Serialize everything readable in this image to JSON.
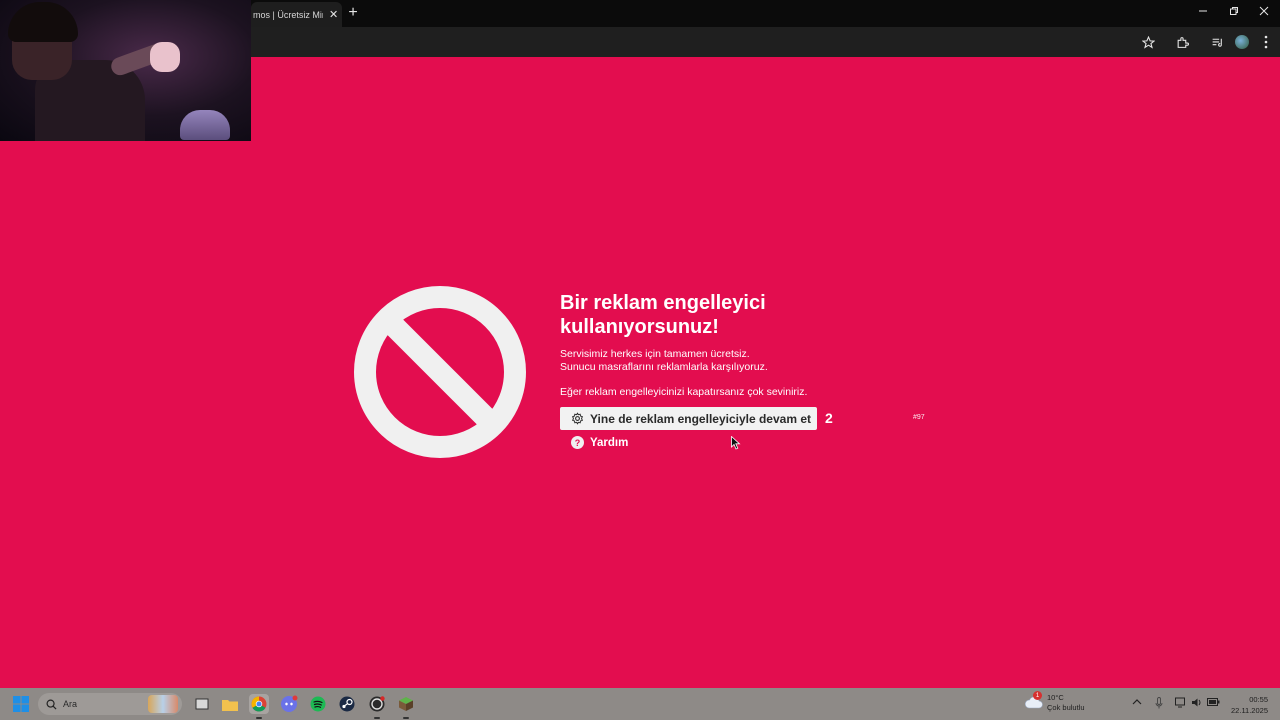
{
  "browser": {
    "tab_title": "mos | Ücretsiz Mine",
    "tab_close": "✕",
    "new_tab": "+"
  },
  "page": {
    "title": "Bir reklam engelleyici kullanıyorsunuz!",
    "desc_line1": "Servisimiz herkes için tamamen ücretsiz.",
    "desc_line2": "Sunucu masraflarını reklamlarla karşılıyoruz.",
    "desc_line3": "Eğer reklam engelleyicinizi kapatırsanız çok seviniriz.",
    "continue_label": "Yine de reklam engelleyiciyle devam et",
    "count": "2",
    "code": "#97",
    "help_icon": "?",
    "help_label": "Yardım",
    "accent": "#e30d4f"
  },
  "taskbar": {
    "search_placeholder": "Ara",
    "weather_temp": "10°C",
    "weather_desc": "Çok bulutlu",
    "weather_badge": "1",
    "time": "00:55",
    "date": "22.11.2025"
  }
}
